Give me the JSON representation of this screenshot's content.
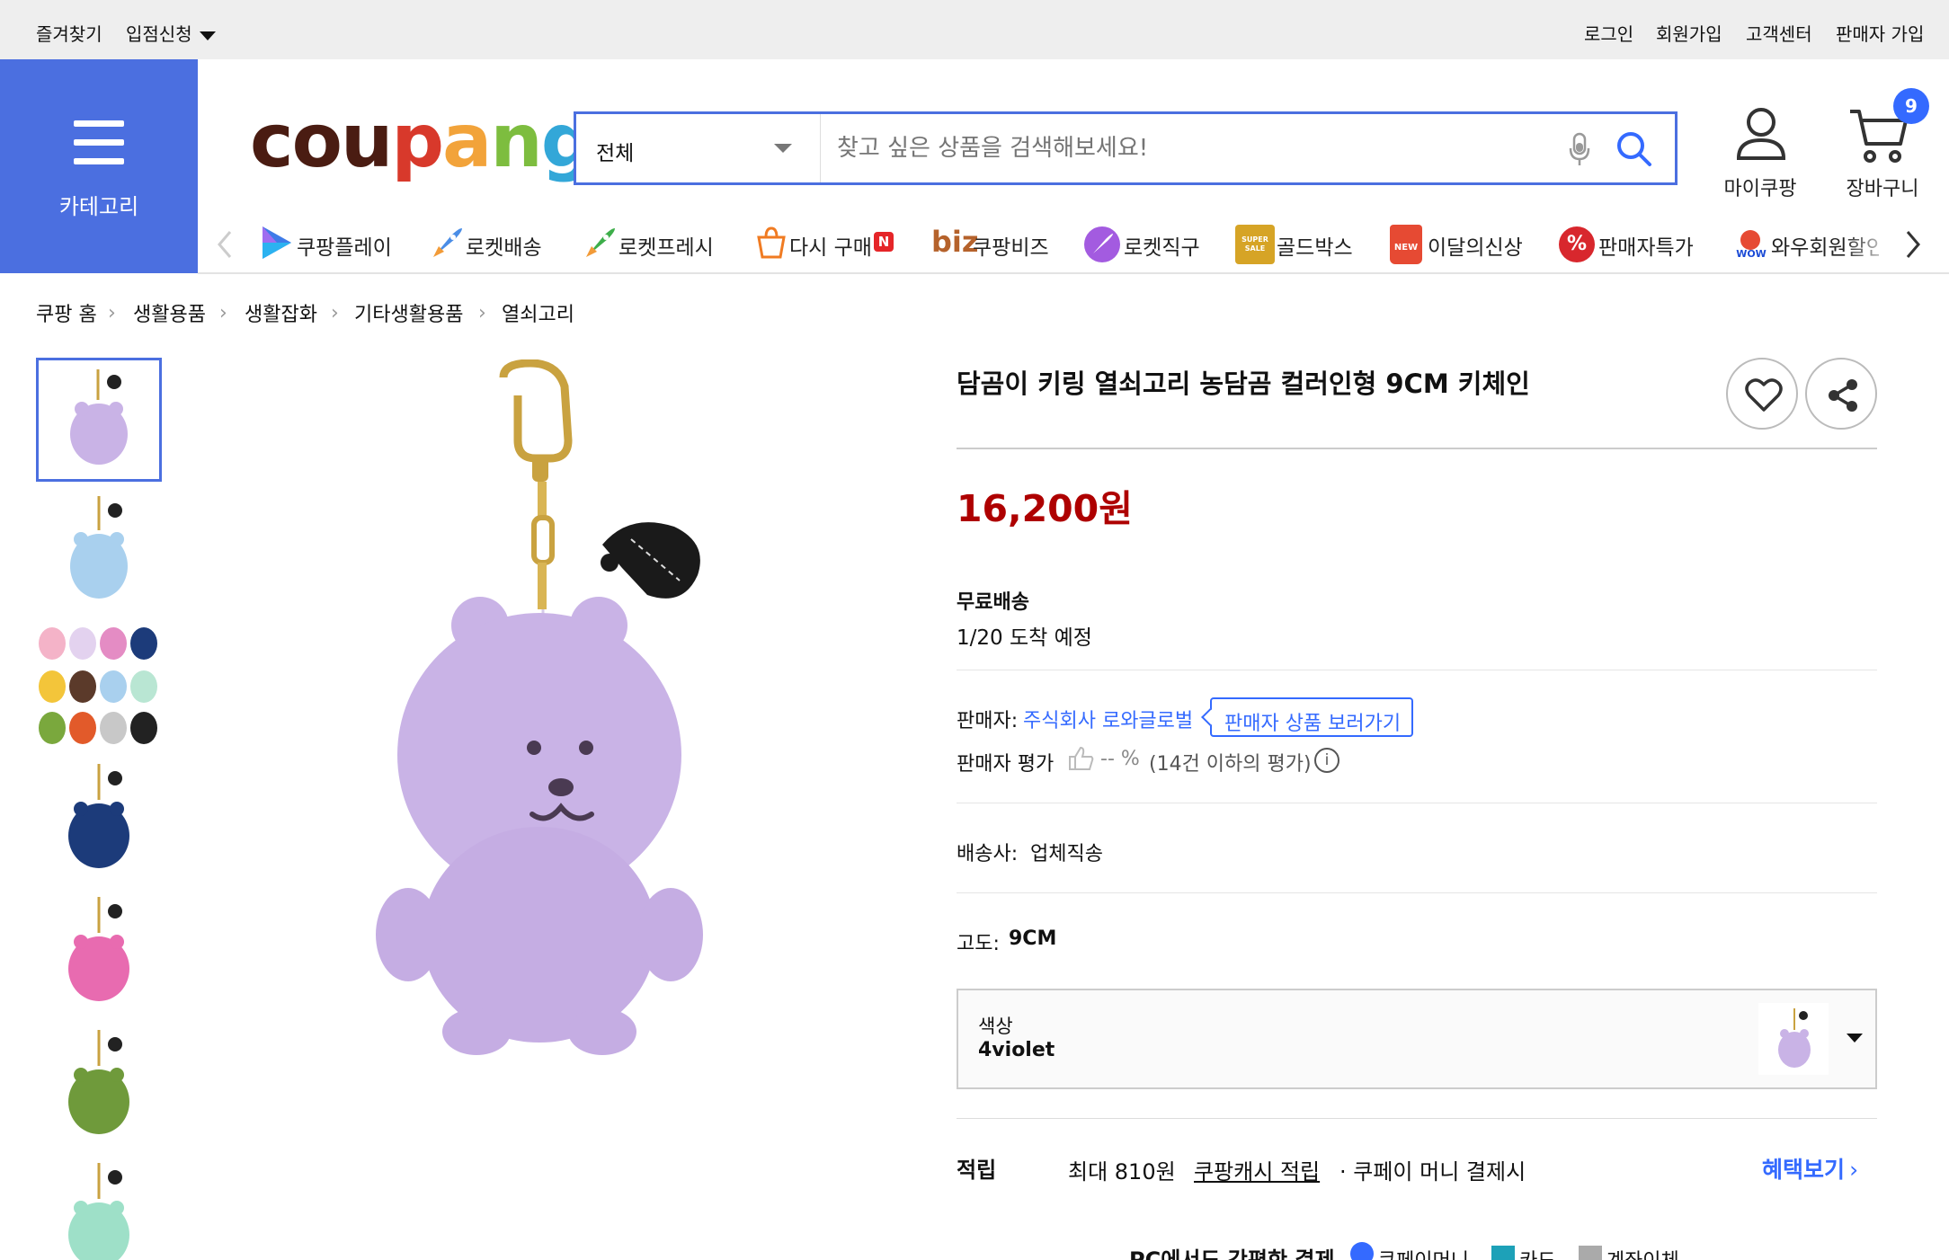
{
  "topbar": {
    "favorites": "즐겨찾기",
    "seller_apply": "입점신청",
    "login": "로그인",
    "signup": "회원가입",
    "customer_center": "고객센터",
    "seller_join": "판매자 가입"
  },
  "header": {
    "category_label": "카테고리",
    "logo_text": "coupang",
    "search_category": "전체",
    "search_placeholder": "찾고 싶은 상품을 검색해보세요!",
    "mycoupang": "마이쿠팡",
    "cart": "장바구니",
    "cart_count": "9"
  },
  "catnav": [
    {
      "label": "쿠팡플레이",
      "icon": "play-icon"
    },
    {
      "label": "로켓배송",
      "icon": "rocket-icon"
    },
    {
      "label": "로켓프레시",
      "icon": "rocket-fresh-icon"
    },
    {
      "label": "다시 구매",
      "icon": "rebuy-icon",
      "badge": "N"
    },
    {
      "label": "쿠팡비즈",
      "icon": "biz-icon",
      "prefix": "biz"
    },
    {
      "label": "로켓직구",
      "icon": "rocket-global-icon"
    },
    {
      "label": "골드박스",
      "icon": "goldbox-icon",
      "icon_text": "SUPER SALE"
    },
    {
      "label": "이달의신상",
      "icon": "new-bag-icon",
      "icon_text": "NEW"
    },
    {
      "label": "판매자특가",
      "icon": "percent-icon",
      "icon_text": "%"
    },
    {
      "label": "와우회원할인",
      "icon": "wow-icon",
      "icon_text": "WOW"
    }
  ],
  "breadcrumb": [
    "쿠팡 홈",
    "생활용품",
    "생활잡화",
    "기타생활용품",
    "열쇠고리"
  ],
  "product": {
    "title": "담곰이 키링 열쇠고리 농담곰 컬러인형 9CM 키체인",
    "price": "16,200원",
    "shipping_title": "무료배송",
    "arrival": "1/20 도착 예정",
    "seller_label": "판매자:",
    "seller_name": "주식회사 로와글로벌",
    "seller_products_button": "판매자 상품 보러가기",
    "seller_rating_label": "판매자 평가",
    "seller_rating_value": "-- %",
    "seller_rating_note": "(14건 이하의 평가)",
    "delivery_label": "배송사:",
    "delivery_value": "업체직송",
    "height_label": "고도:",
    "height_value": "9CM",
    "option_label": "색상",
    "option_value": "4violet",
    "reward_label": "적립",
    "reward_max": "최대 810원",
    "reward_link": "쿠팡캐시 적립",
    "reward_note": "· 쿠페이 머니 결제시",
    "benefit_link": "혜택보기",
    "pay_line_title": "PC에서도 간편한 결제",
    "pay_coupay": "쿠페이머니",
    "pay_card": "카드",
    "pay_account": "계좌이체"
  },
  "colors": {
    "accent": "#4b6fe0",
    "price": "#ae0000",
    "link": "#346aff",
    "main_plush": "#c9b3e6",
    "thumbs": [
      "#c9b3e6",
      "#a9d0ee",
      "grid",
      "#1c3b7a",
      "#e86bb0",
      "#6f9a3b",
      "#9ee0c8"
    ]
  }
}
